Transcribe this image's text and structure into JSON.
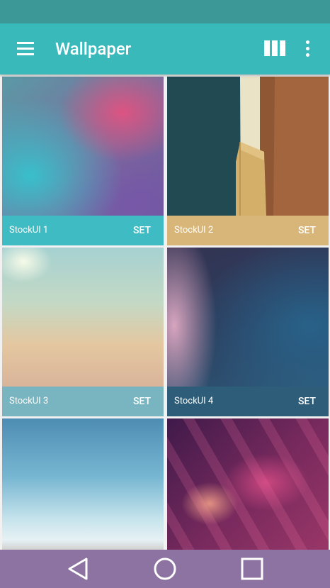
{
  "app_bar": {
    "title": "Wallpaper",
    "navigation_icon": "hamburger-menu-icon",
    "actions": [
      {
        "icon": "grid-view-icon"
      },
      {
        "icon": "more-vert-icon"
      }
    ]
  },
  "wallpapers": [
    {
      "name": "StockUI 1",
      "action": "SET",
      "caption_color": "#3fbbc3"
    },
    {
      "name": "StockUI 2",
      "action": "SET",
      "caption_color": "#d8b67a"
    },
    {
      "name": "StockUI 3",
      "action": "SET",
      "caption_color": "#78b5c0"
    },
    {
      "name": "StockUI 4",
      "action": "SET",
      "caption_color": "#2d5d78"
    },
    {
      "name": null,
      "action": null
    },
    {
      "name": null,
      "action": null
    }
  ],
  "navigation_bar": {
    "buttons": [
      {
        "icon": "back-triangle-icon"
      },
      {
        "icon": "home-circle-icon"
      },
      {
        "icon": "recents-square-icon"
      }
    ]
  },
  "colors": {
    "status_bar": "#3b9897",
    "app_bar": "#3ab9bb",
    "navigation_bar": "#8c73a2",
    "background": "#f1f1f1"
  }
}
